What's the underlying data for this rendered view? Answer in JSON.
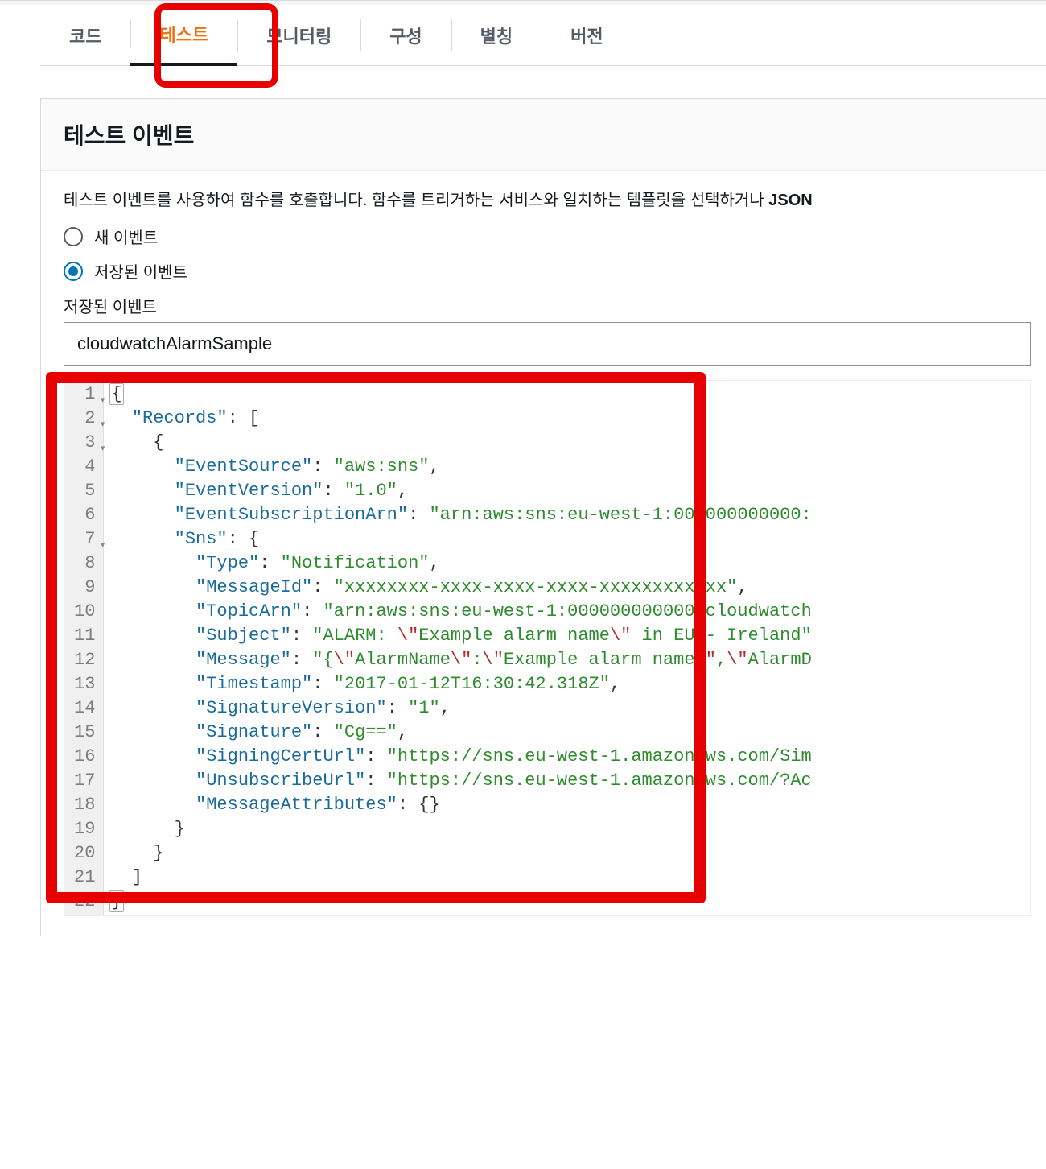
{
  "tabs": {
    "code": "코드",
    "test": "테스트",
    "monitor": "모니터링",
    "config": "구성",
    "alias": "별칭",
    "version": "버전"
  },
  "panel": {
    "title": "테스트 이벤트",
    "helper_prefix": "테스트 이벤트를 사용하여 함수를 호출합니다. 함수를 트리거하는 서비스와 일치하는 템플릿을 선택하거나 ",
    "helper_bold": "JSON"
  },
  "radios": {
    "new_event": "새 이벤트",
    "saved_event": "저장된 이벤트"
  },
  "saved_event": {
    "label": "저장된 이벤트",
    "value": "cloudwatchAlarmSample"
  },
  "code_lines": [
    {
      "n": 1,
      "fold": true,
      "tokens": [
        [
          "brace-hl",
          "{"
        ]
      ]
    },
    {
      "n": 2,
      "fold": true,
      "tokens": [
        [
          "punc",
          "  "
        ],
        [
          "key",
          "\"Records\""
        ],
        [
          "punc",
          ": ["
        ]
      ]
    },
    {
      "n": 3,
      "fold": true,
      "tokens": [
        [
          "punc",
          "    {"
        ]
      ]
    },
    {
      "n": 4,
      "fold": false,
      "tokens": [
        [
          "punc",
          "      "
        ],
        [
          "key",
          "\"EventSource\""
        ],
        [
          "punc",
          ": "
        ],
        [
          "str",
          "\"aws:sns\""
        ],
        [
          "punc",
          ","
        ]
      ]
    },
    {
      "n": 5,
      "fold": false,
      "tokens": [
        [
          "punc",
          "      "
        ],
        [
          "key",
          "\"EventVersion\""
        ],
        [
          "punc",
          ": "
        ],
        [
          "str",
          "\"1.0\""
        ],
        [
          "punc",
          ","
        ]
      ]
    },
    {
      "n": 6,
      "fold": false,
      "tokens": [
        [
          "punc",
          "      "
        ],
        [
          "key",
          "\"EventSubscriptionArn\""
        ],
        [
          "punc",
          ": "
        ],
        [
          "str",
          "\"arn:aws:sns:eu-west-1:000000000000:"
        ]
      ]
    },
    {
      "n": 7,
      "fold": true,
      "tokens": [
        [
          "punc",
          "      "
        ],
        [
          "key",
          "\"Sns\""
        ],
        [
          "punc",
          ": {"
        ]
      ]
    },
    {
      "n": 8,
      "fold": false,
      "tokens": [
        [
          "punc",
          "        "
        ],
        [
          "key",
          "\"Type\""
        ],
        [
          "punc",
          ": "
        ],
        [
          "str",
          "\"Notification\""
        ],
        [
          "punc",
          ","
        ]
      ]
    },
    {
      "n": 9,
      "fold": false,
      "tokens": [
        [
          "punc",
          "        "
        ],
        [
          "key",
          "\"MessageId\""
        ],
        [
          "punc",
          ": "
        ],
        [
          "str",
          "\"xxxxxxxx-xxxx-xxxx-xxxx-xxxxxxxxxxxx\""
        ],
        [
          "punc",
          ","
        ]
      ]
    },
    {
      "n": 10,
      "fold": false,
      "tokens": [
        [
          "punc",
          "        "
        ],
        [
          "key",
          "\"TopicArn\""
        ],
        [
          "punc",
          ": "
        ],
        [
          "str",
          "\"arn:aws:sns:eu-west-1:000000000000:cloudwatch"
        ]
      ]
    },
    {
      "n": 11,
      "fold": false,
      "tokens": [
        [
          "punc",
          "        "
        ],
        [
          "key",
          "\"Subject\""
        ],
        [
          "punc",
          ": "
        ],
        [
          "str",
          "\"ALARM: "
        ],
        [
          "esc",
          "\\\""
        ],
        [
          "str",
          "Example alarm name"
        ],
        [
          "esc",
          "\\\""
        ],
        [
          "str",
          " in EU - Ireland\""
        ]
      ]
    },
    {
      "n": 12,
      "fold": false,
      "tokens": [
        [
          "punc",
          "        "
        ],
        [
          "key",
          "\"Message\""
        ],
        [
          "punc",
          ": "
        ],
        [
          "str",
          "\"{"
        ],
        [
          "esc",
          "\\\""
        ],
        [
          "str",
          "AlarmName"
        ],
        [
          "esc",
          "\\\""
        ],
        [
          "str",
          ":"
        ],
        [
          "esc",
          "\\\""
        ],
        [
          "str",
          "Example alarm name"
        ],
        [
          "esc",
          "\\\""
        ],
        [
          "str",
          ","
        ],
        [
          "esc",
          "\\\""
        ],
        [
          "str",
          "AlarmD"
        ]
      ]
    },
    {
      "n": 13,
      "fold": false,
      "tokens": [
        [
          "punc",
          "        "
        ],
        [
          "key",
          "\"Timestamp\""
        ],
        [
          "punc",
          ": "
        ],
        [
          "str",
          "\"2017-01-12T16:30:42.318Z\""
        ],
        [
          "punc",
          ","
        ]
      ]
    },
    {
      "n": 14,
      "fold": false,
      "tokens": [
        [
          "punc",
          "        "
        ],
        [
          "key",
          "\"SignatureVersion\""
        ],
        [
          "punc",
          ": "
        ],
        [
          "str",
          "\"1\""
        ],
        [
          "punc",
          ","
        ]
      ]
    },
    {
      "n": 15,
      "fold": false,
      "tokens": [
        [
          "punc",
          "        "
        ],
        [
          "key",
          "\"Signature\""
        ],
        [
          "punc",
          ": "
        ],
        [
          "str",
          "\"Cg==\""
        ],
        [
          "punc",
          ","
        ]
      ]
    },
    {
      "n": 16,
      "fold": false,
      "tokens": [
        [
          "punc",
          "        "
        ],
        [
          "key",
          "\"SigningCertUrl\""
        ],
        [
          "punc",
          ": "
        ],
        [
          "str",
          "\"https://sns.eu-west-1.amazonaws.com/Sim"
        ]
      ]
    },
    {
      "n": 17,
      "fold": false,
      "tokens": [
        [
          "punc",
          "        "
        ],
        [
          "key",
          "\"UnsubscribeUrl\""
        ],
        [
          "punc",
          ": "
        ],
        [
          "str",
          "\"https://sns.eu-west-1.amazonaws.com/?Ac"
        ]
      ]
    },
    {
      "n": 18,
      "fold": false,
      "tokens": [
        [
          "punc",
          "        "
        ],
        [
          "key",
          "\"MessageAttributes\""
        ],
        [
          "punc",
          ": {}"
        ]
      ]
    },
    {
      "n": 19,
      "fold": false,
      "tokens": [
        [
          "punc",
          "      }"
        ]
      ]
    },
    {
      "n": 20,
      "fold": false,
      "tokens": [
        [
          "punc",
          "    }"
        ]
      ]
    },
    {
      "n": 21,
      "fold": false,
      "tokens": [
        [
          "punc",
          "  ]"
        ]
      ]
    },
    {
      "n": 22,
      "fold": false,
      "tokens": [
        [
          "brace-hl",
          "}"
        ]
      ]
    }
  ]
}
